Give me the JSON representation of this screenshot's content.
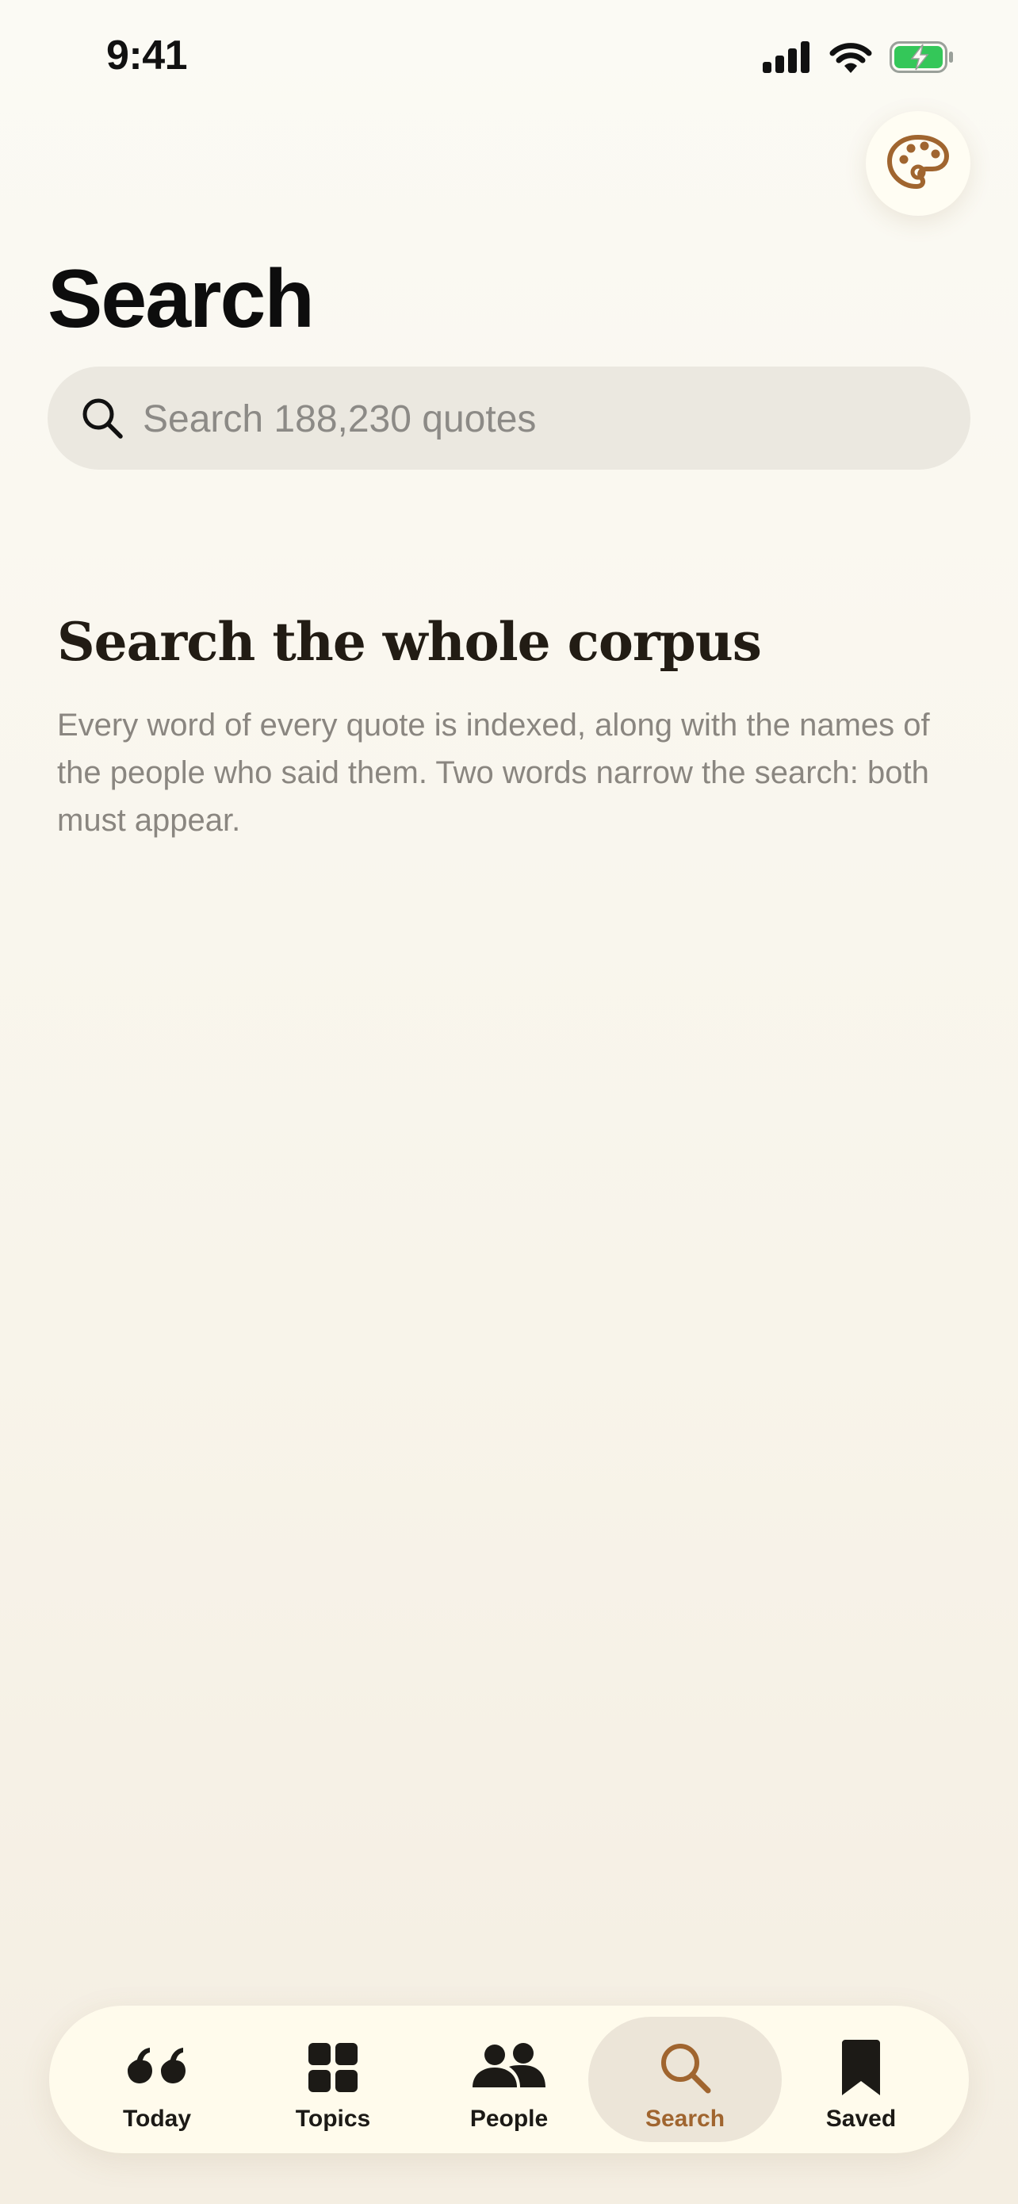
{
  "status_bar": {
    "time": "9:41"
  },
  "header": {
    "title": "Search",
    "theme_button_icon": "palette-icon"
  },
  "search": {
    "placeholder": "Search 188,230 quotes",
    "value": "",
    "icon": "search-icon"
  },
  "empty_state": {
    "title": "Search the whole corpus",
    "description": "Every word of every quote is indexed, along with the names of the people who said them. Two words narrow the search: both must appear."
  },
  "tab_bar": {
    "items": [
      {
        "label": "Today",
        "icon": "quote-icon",
        "active": false
      },
      {
        "label": "Topics",
        "icon": "grid-icon",
        "active": false
      },
      {
        "label": "People",
        "icon": "people-icon",
        "active": false
      },
      {
        "label": "Search",
        "icon": "search-icon",
        "active": true
      },
      {
        "label": "Saved",
        "icon": "bookmark-icon",
        "active": false
      }
    ]
  },
  "colors": {
    "accent": "#a0652f",
    "background": "#f9f6ee",
    "battery": "#34c759"
  }
}
